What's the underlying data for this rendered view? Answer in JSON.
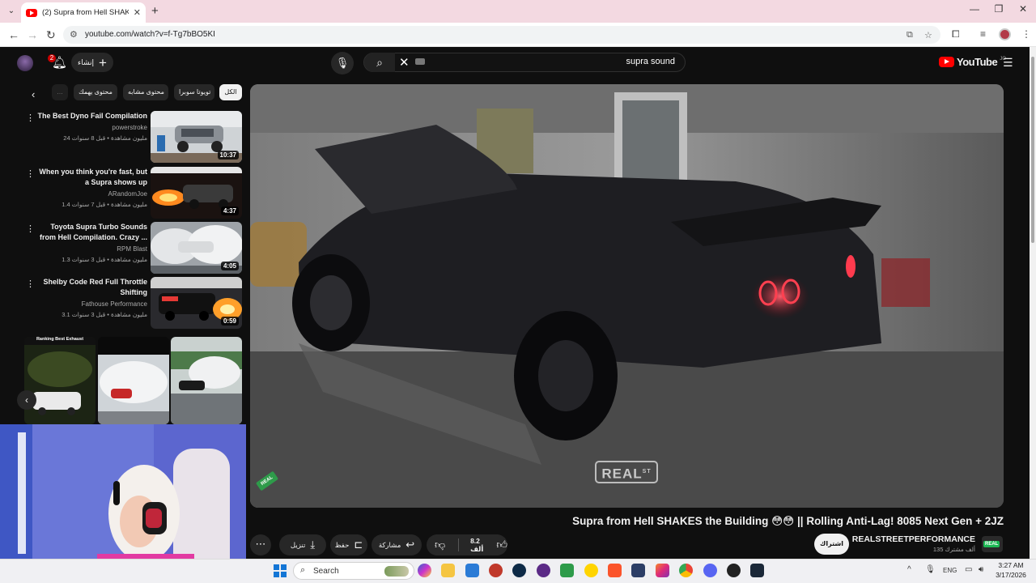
{
  "browser": {
    "tab_title": "(2) Supra from Hell SHAKES the",
    "new_tab": "+",
    "url": "youtube.com/watch?v=f-Tg7bBO5KI"
  },
  "masthead": {
    "notification_count": "2",
    "create_label": "إنشاء",
    "search_query": "supra sound",
    "logo_text": "YouTube",
    "logo_region": "JO"
  },
  "chips": [
    {
      "label": "الكل",
      "active": true
    },
    {
      "label": "تويوتا سوبرا",
      "active": false
    },
    {
      "label": "محتوى مشابه",
      "active": false
    },
    {
      "label": "محتوى يهمك",
      "active": false
    }
  ],
  "recommendations": [
    {
      "title": "The Best Dyno Fail Compilation",
      "channel": "powerstroke",
      "meta": "24 مليون مشاهدة • قبل 8 سنوات",
      "duration": "10:37"
    },
    {
      "title": "When you think you're fast, but a Supra shows up",
      "channel": "ARandomJoe",
      "meta": "1.4 مليون مشاهدة • قبل 7 سنوات",
      "duration": "4:37"
    },
    {
      "title": "Toyota Supra Turbo Sounds from Hell Compilation. Crazy ...",
      "channel": "RPM Blast",
      "meta": "1.3 مليون مشاهدة • قبل 3 سنوات",
      "duration": "4:05"
    },
    {
      "title": "Shelby Code Red Full Throttle Shifting",
      "channel": "Fathouse Performance",
      "meta": "3.1 مليون مشاهدة • قبل 3 سنوات",
      "duration": "0:59"
    }
  ],
  "shorts": {
    "first_caption": "Ranking Best Exhaust"
  },
  "video": {
    "title": "Supra from Hell SHAKES the Building 😳😳 || Rolling Anti-Lag! 8085 Next Gen + 2JZ",
    "watermark": "REAL",
    "watermark_sup": "ST",
    "corner_tag": "REAL"
  },
  "actions": {
    "likes": "8.2 ألف",
    "share": "مشاركة",
    "save": "حفظ",
    "download": "تنزيل"
  },
  "channel": {
    "name": "REALSTREETPERFORMANCE",
    "subscribers": "135 ألف مشترك",
    "subscribe_label": "اشتراك"
  },
  "taskbar": {
    "search_placeholder": "Search",
    "language": "ENG",
    "time": "3:27 AM",
    "date": "3/17/2026"
  },
  "colors": {
    "yt_red": "#ff0000",
    "background": "#0f0f0f",
    "tab_strip": "#f3d9e1"
  }
}
